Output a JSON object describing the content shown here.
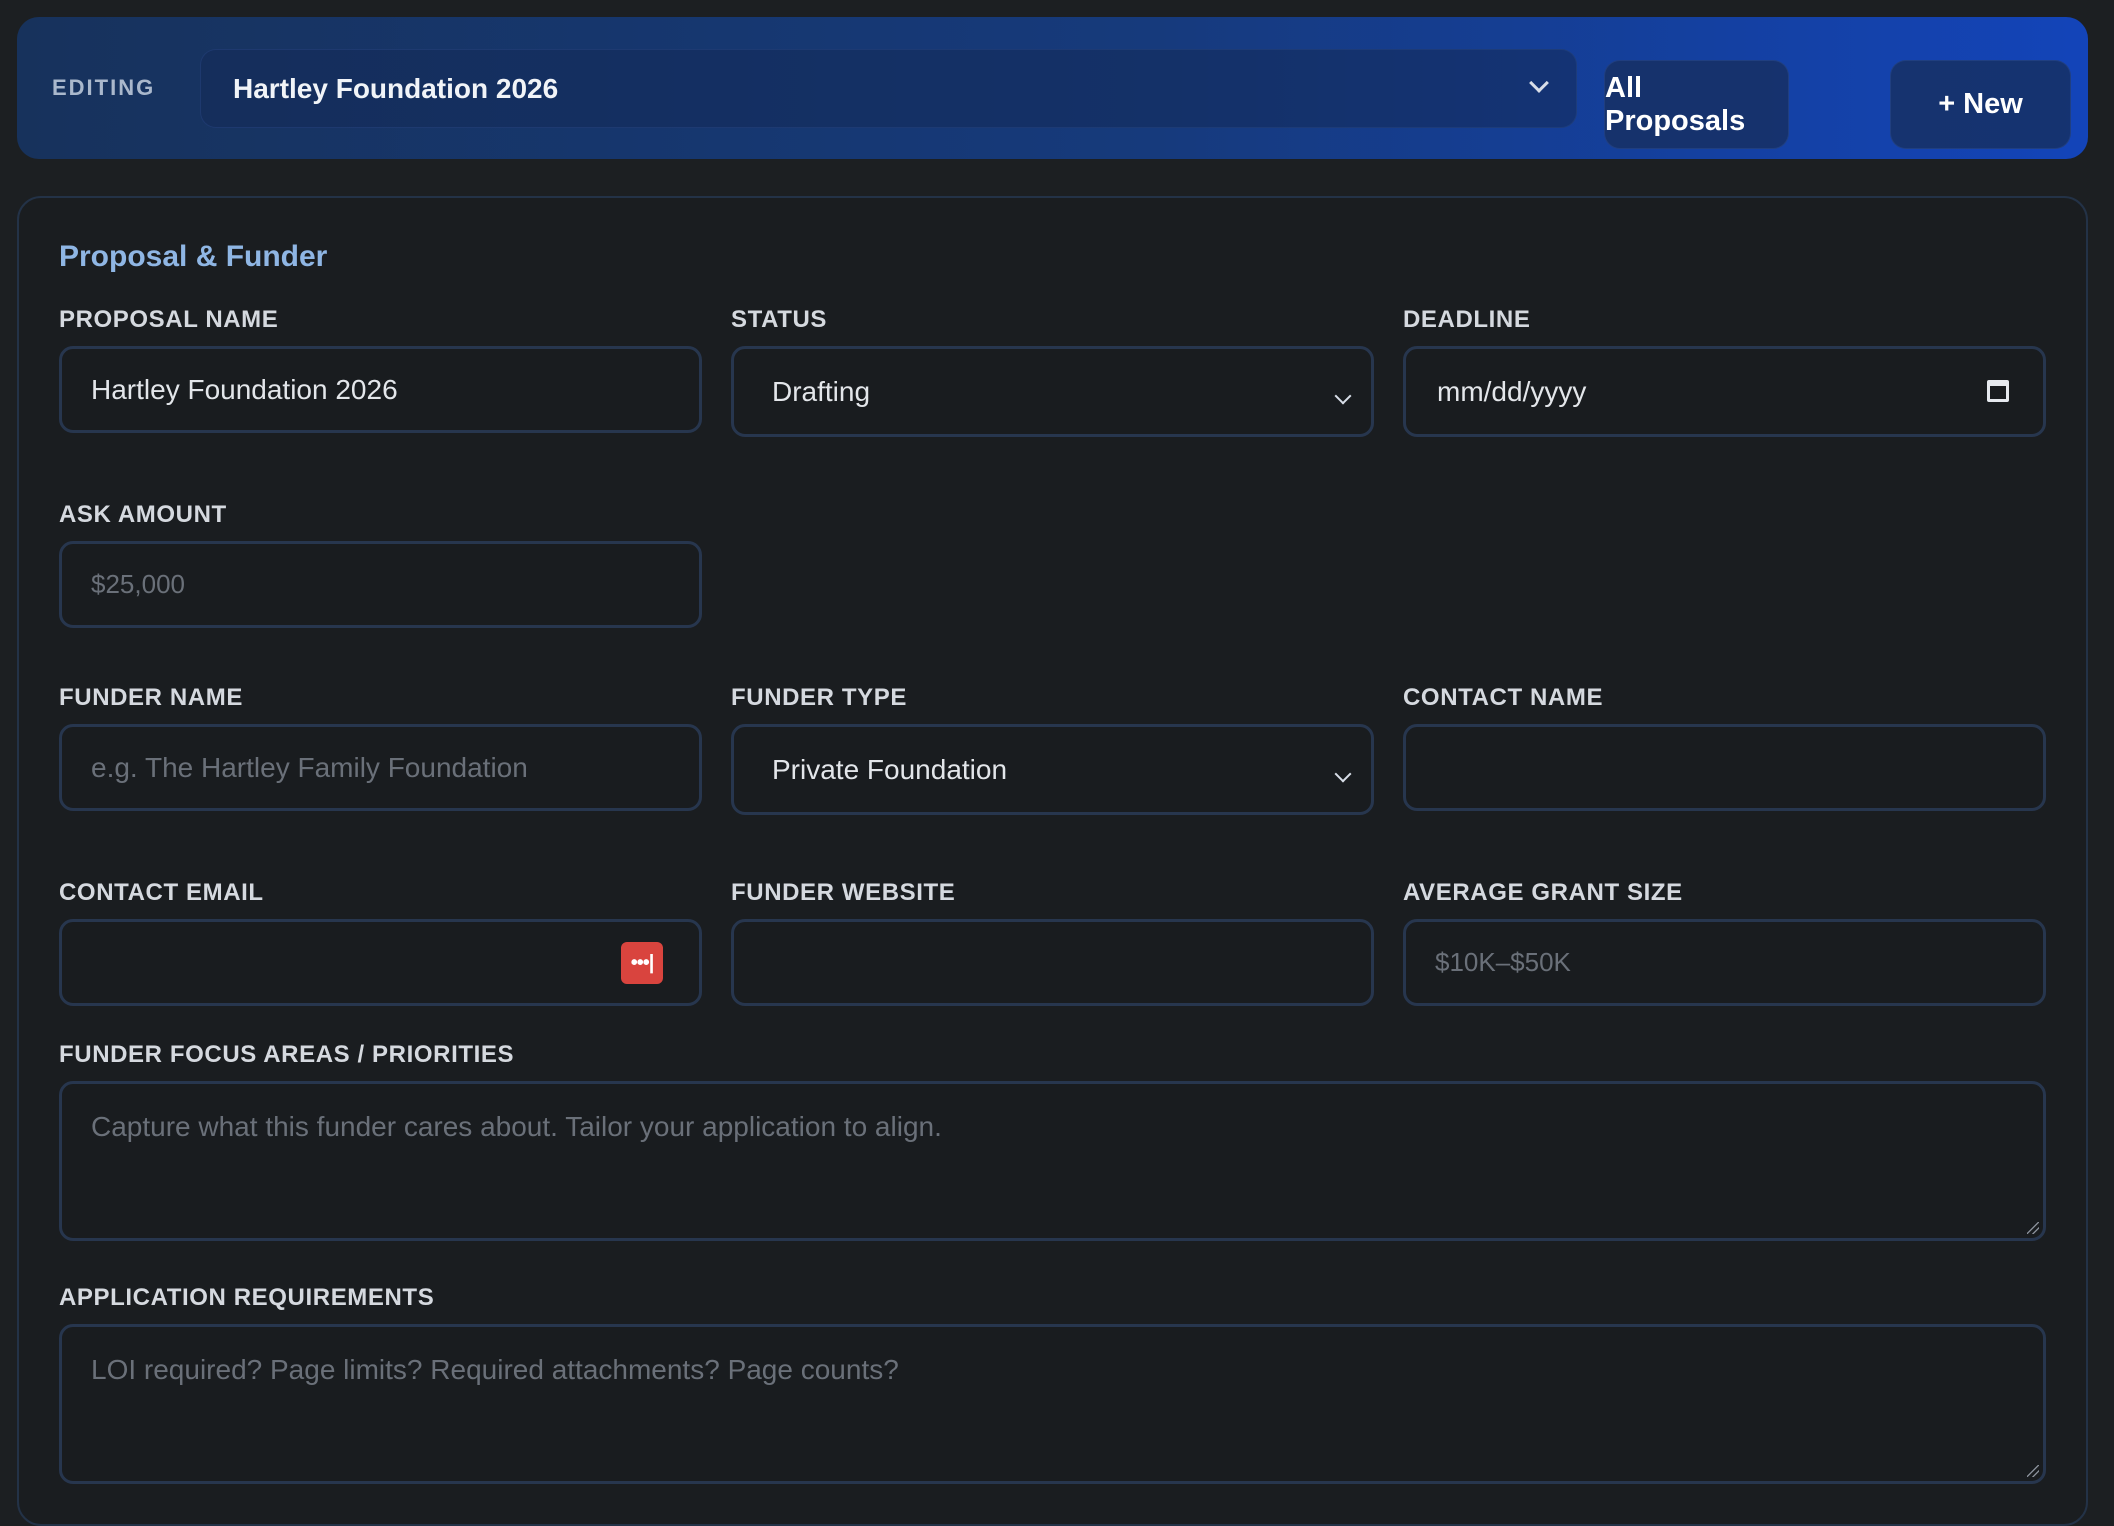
{
  "topbar": {
    "editing_label": "EDITING",
    "proposal_selected": "Hartley Foundation 2026",
    "all_proposals_label": "All Proposals",
    "new_label": "+ New"
  },
  "section": {
    "title": "Proposal & Funder"
  },
  "fields": {
    "proposal_name": {
      "label": "PROPOSAL NAME",
      "value": "Hartley Foundation 2026"
    },
    "status": {
      "label": "STATUS",
      "value": "Drafting"
    },
    "deadline": {
      "label": "DEADLINE",
      "value": "mm/dd/yyyy"
    },
    "ask_amount": {
      "label": "ASK AMOUNT",
      "placeholder": "$25,000"
    },
    "funder_name": {
      "label": "FUNDER NAME",
      "placeholder": "e.g. The Hartley Family Foundation"
    },
    "funder_type": {
      "label": "FUNDER TYPE",
      "value": "Private Foundation"
    },
    "contact_name": {
      "label": "CONTACT NAME",
      "value": ""
    },
    "contact_email": {
      "label": "CONTACT EMAIL",
      "value": "",
      "autofill_icon": "password-manager-icon"
    },
    "funder_website": {
      "label": "FUNDER WEBSITE",
      "value": ""
    },
    "average_grant_size": {
      "label": "AVERAGE GRANT SIZE",
      "placeholder": "$10K–$50K"
    },
    "focus_areas": {
      "label": "FUNDER FOCUS AREAS / PRIORITIES",
      "placeholder": "Capture what this funder cares about. Tailor your application to align."
    },
    "requirements": {
      "label": "APPLICATION REQUIREMENTS",
      "placeholder": "LOI required? Page limits? Required attachments? Page counts?"
    }
  },
  "colors": {
    "accent_title": "#8fb6e4",
    "topbar_gradient_end": "#1344b9",
    "autofill_icon": "#d9443e"
  }
}
